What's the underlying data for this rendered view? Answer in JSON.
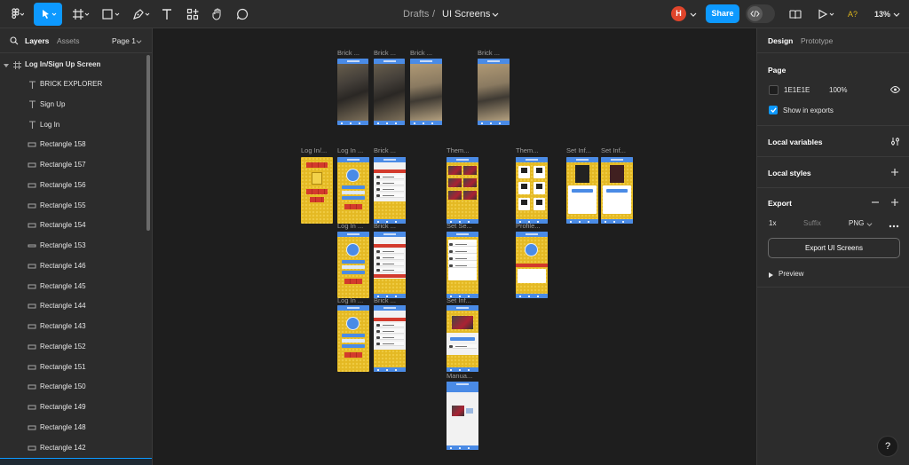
{
  "toolbar": {
    "breadcrumb_project": "Drafts",
    "breadcrumb_separator": "/",
    "file_name": "UI Screens",
    "user_initial": "H",
    "share_label": "Share",
    "notification_badge": "A?",
    "zoom": "13%",
    "icons": [
      "figma-menu-icon",
      "move-tool-icon",
      "frame-tool-icon",
      "shape-tool-icon",
      "pen-tool-icon",
      "text-tool-icon",
      "resources-icon",
      "hand-tool-icon",
      "comment-icon",
      "dev-mode-icon",
      "library-icon",
      "present-icon"
    ]
  },
  "left_panel": {
    "tab_layers": "Layers",
    "tab_assets": "Assets",
    "page_selector": "Page 1",
    "frame_name": "Log In/Sign Up Screen",
    "layers": [
      {
        "name": "BRICK EXPLORER",
        "type": "text"
      },
      {
        "name": "Sign Up",
        "type": "text"
      },
      {
        "name": "Log In",
        "type": "text"
      },
      {
        "name": "Rectangle 158",
        "type": "rect"
      },
      {
        "name": "Rectangle 157",
        "type": "rect"
      },
      {
        "name": "Rectangle 156",
        "type": "rect"
      },
      {
        "name": "Rectangle 155",
        "type": "rect"
      },
      {
        "name": "Rectangle 154",
        "type": "rect"
      },
      {
        "name": "Rectangle 153",
        "type": "line"
      },
      {
        "name": "Rectangle 146",
        "type": "rect"
      },
      {
        "name": "Rectangle 145",
        "type": "rect"
      },
      {
        "name": "Rectangle 144",
        "type": "rect"
      },
      {
        "name": "Rectangle 143",
        "type": "rect"
      },
      {
        "name": "Rectangle 152",
        "type": "rect"
      },
      {
        "name": "Rectangle 151",
        "type": "rect"
      },
      {
        "name": "Rectangle 150",
        "type": "rect"
      },
      {
        "name": "Rectangle 149",
        "type": "rect"
      },
      {
        "name": "Rectangle 148",
        "type": "rect"
      },
      {
        "name": "Rectangle 142",
        "type": "rect"
      }
    ]
  },
  "canvas": {
    "frame_labels": {
      "brick1": "Brick ...",
      "brick2": "Brick ...",
      "brick3": "Brick ...",
      "brick4": "Brick ...",
      "login1": "Log In/...",
      "login2": "Log In ...",
      "login3": "Log In ...",
      "login4": "Log In ...",
      "brick5": "Brick ...",
      "brick6": "Brick ...",
      "brick7": "Brick ...",
      "them1": "Them...",
      "them2": "Them...",
      "setinf1": "Set Inf...",
      "setinf2": "Set Inf...",
      "setinf3": "Set Inf...",
      "setse": "Set Se...",
      "profile": "Profile...",
      "manual": "Manua..."
    }
  },
  "right_panel": {
    "tab_design": "Design",
    "tab_prototype": "Prototype",
    "page_section_title": "Page",
    "page_color_hex": "1E1E1E",
    "page_opacity": "100%",
    "show_in_exports": "Show in exports",
    "local_variables": "Local variables",
    "local_styles": "Local styles",
    "export_title": "Export",
    "export_scale": "1x",
    "export_suffix_placeholder": "Suffix",
    "export_format": "PNG",
    "export_button": "Export UI Screens",
    "preview_label": "Preview"
  },
  "help_label": "?",
  "colors": {
    "accent": "#0d99ff",
    "canvas_bg": "#1e1e1e",
    "panel_bg": "#2c2c2c",
    "screen_blue": "#4a8be6",
    "screen_yellow": "#e4b923",
    "brick_red": "#d33a2c",
    "avatar_red": "#e0452b"
  }
}
